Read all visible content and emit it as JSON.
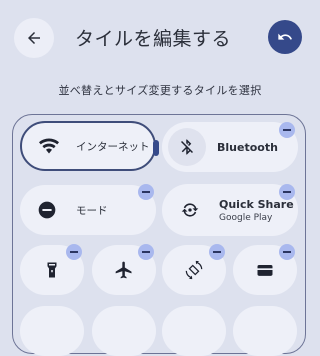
{
  "header": {
    "title": "タイルを編集する",
    "back_icon": "arrow-left-icon",
    "reset_icon": "undo-icon"
  },
  "subtitle": "並べ替えとサイズ変更するタイルを選択",
  "tiles": [
    {
      "label": "インターネット",
      "icon": "wifi-icon",
      "size": "wide",
      "selected": true
    },
    {
      "label": "Bluetooth",
      "icon": "bluetooth-off-icon",
      "size": "wide"
    },
    {
      "label": "モード",
      "icon": "do-not-disturb-icon",
      "size": "wide"
    },
    {
      "label": "Quick Share",
      "sublabel": "Google Play",
      "icon": "quick-share-icon",
      "size": "wide"
    },
    {
      "label": "",
      "icon": "flashlight-icon",
      "size": "small"
    },
    {
      "label": "",
      "icon": "airplane-icon",
      "size": "small"
    },
    {
      "label": "",
      "icon": "auto-rotate-icon",
      "size": "small"
    },
    {
      "label": "",
      "icon": "wallet-icon",
      "size": "small"
    }
  ],
  "colors": {
    "background": "#dde1ee",
    "tile": "#eef0f8",
    "accent": "#35498a",
    "remove_badge": "#a9b8ee"
  }
}
